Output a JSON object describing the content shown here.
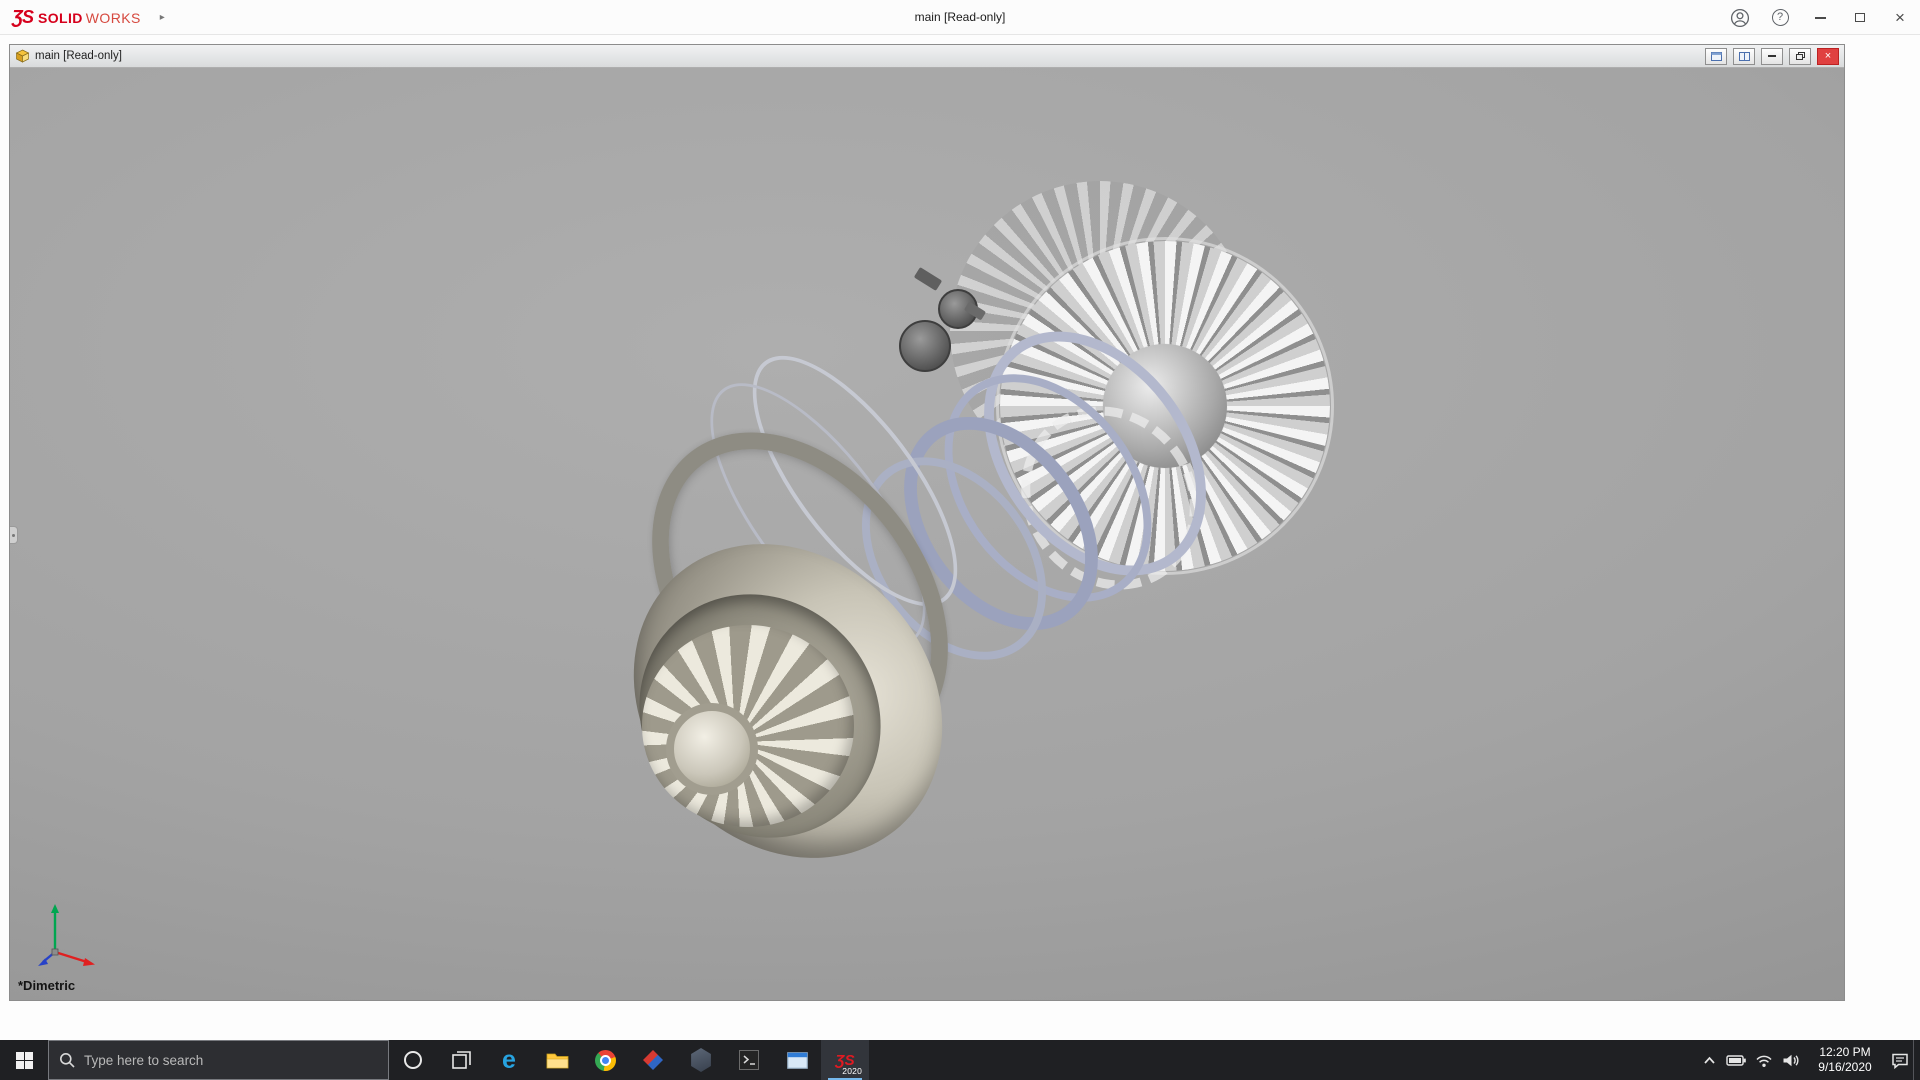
{
  "colors": {
    "brand_red": "#d6001c",
    "taskbar_background": "#1f2023",
    "active_app_accent": "#76b9ed",
    "doc_close_red": "#e04040",
    "viewport_gray": "#a3a3a3"
  },
  "app": {
    "logo_glyph": "ƷS",
    "brand_bold": "SOLID",
    "brand_light": "WORKS",
    "menu_expand_arrow": "▸",
    "title": "main [Read-only]",
    "controls": {
      "help_glyph": "?",
      "close_glyph": "×"
    }
  },
  "document": {
    "title": "main [Read-only]",
    "view_label": "*Dimetric",
    "close_glyph": "×"
  },
  "taskbar": {
    "search_placeholder": "Type here to search",
    "edge_glyph": "e",
    "sw_logo_glyph": "ƷS",
    "sw_year": "2020",
    "tray": {
      "time": "12:20 PM",
      "date": "9/16/2020"
    }
  }
}
